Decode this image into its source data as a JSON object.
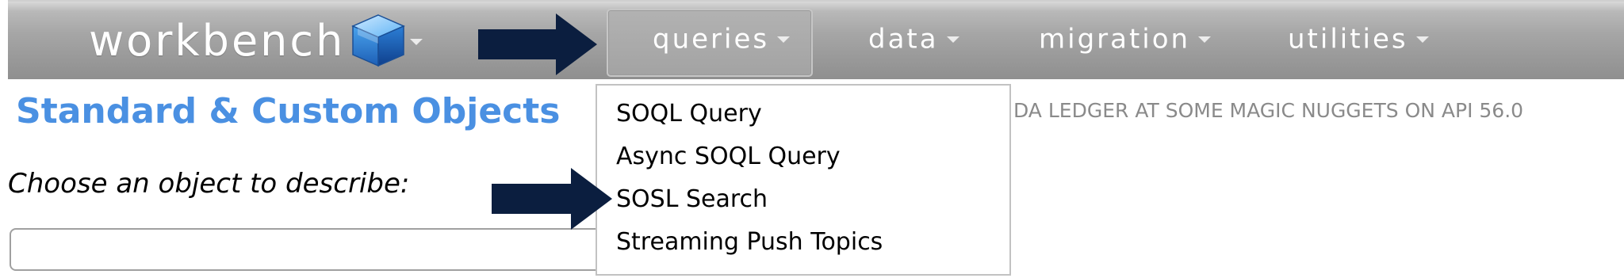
{
  "app": {
    "logo_text": "workbench"
  },
  "nav": {
    "queries": "queries",
    "data": "data",
    "migration": "migration",
    "utilities": "utilities"
  },
  "page": {
    "title": "Standard & Custom Objects",
    "subtitle": "Choose an object to describe:",
    "org_info": "DA LEDGER AT SOME MAGIC NUGGETS ON API 56.0"
  },
  "queries_menu": {
    "items": [
      {
        "label": "SOQL Query"
      },
      {
        "label": "Async SOQL Query"
      },
      {
        "label": "SOSL Search"
      },
      {
        "label": "Streaming Push Topics"
      }
    ]
  },
  "colors": {
    "title_blue": "#4a90e2",
    "arrow_navy": "#0b1e3f",
    "nav_gray": "#a6a6a6"
  },
  "icons": {
    "logo": "cube-icon",
    "caret": "chevron-down-icon",
    "annotation": "arrow-right-icon"
  }
}
